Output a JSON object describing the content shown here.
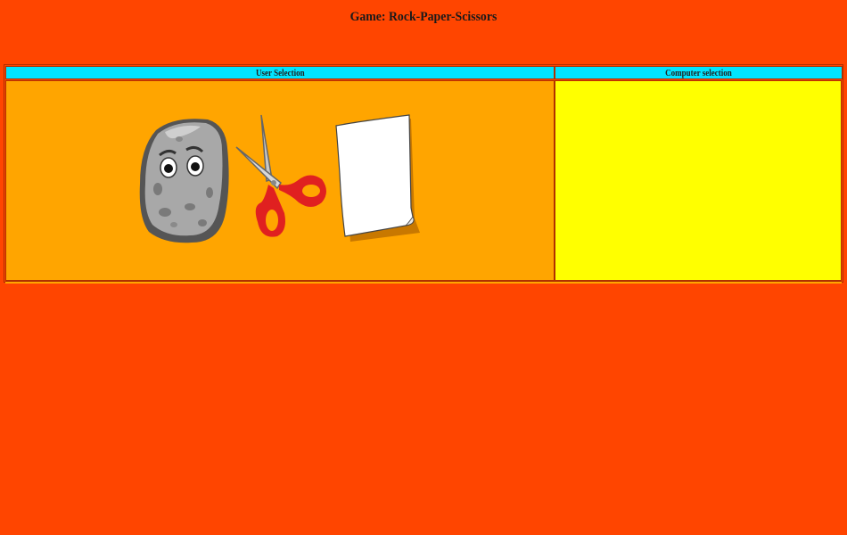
{
  "page": {
    "title": "Game: Rock-Paper-Scissors"
  },
  "table": {
    "user_header": "User Selection",
    "computer_header": "Computer selection"
  },
  "choices": [
    {
      "name": "rock",
      "icon": "rock-icon"
    },
    {
      "name": "scissors",
      "icon": "scissors-icon"
    },
    {
      "name": "paper",
      "icon": "paper-icon"
    }
  ],
  "colors": {
    "background": "#ff4500",
    "header": "#00e5ff",
    "user_cell": "#ffa500",
    "computer_cell": "#ffff00"
  }
}
